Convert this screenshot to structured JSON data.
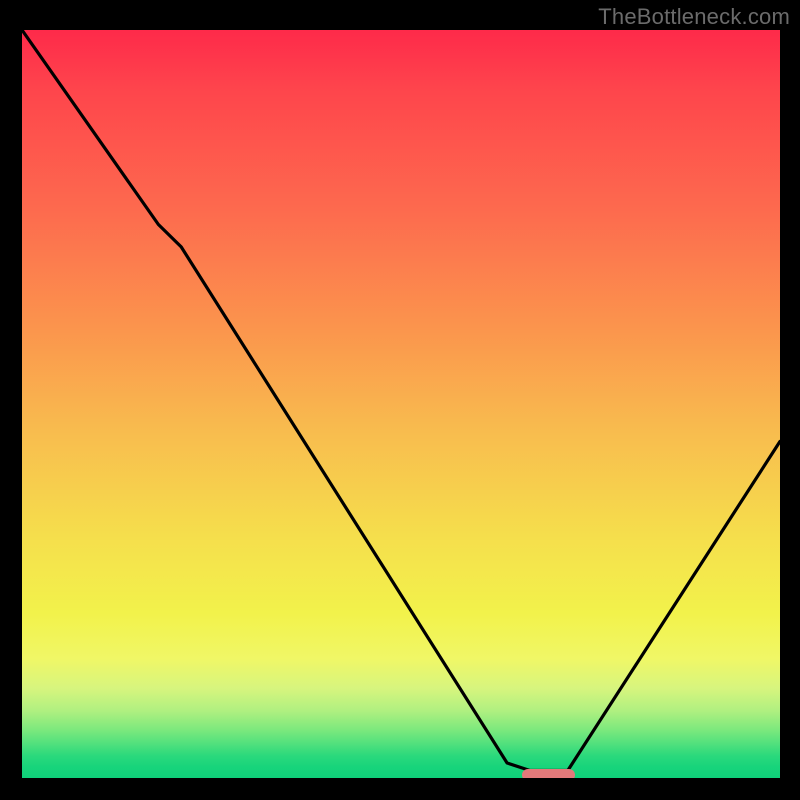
{
  "watermark": "TheBottleneck.com",
  "colors": {
    "background": "#000000",
    "curve": "#000000",
    "marker": "#e2797a",
    "watermark_text": "#6b6b6b"
  },
  "chart_data": {
    "type": "line",
    "title": "",
    "xlabel": "",
    "ylabel": "",
    "xlim": [
      0,
      100
    ],
    "ylim": [
      0,
      100
    ],
    "grid": false,
    "series": [
      {
        "name": "bottleneck-curve",
        "x": [
          0,
          18,
          21,
          64,
          67,
          72,
          100
        ],
        "values": [
          100,
          74,
          71,
          2,
          1,
          1,
          45
        ]
      }
    ],
    "annotations": [
      {
        "name": "optimal-marker",
        "x_start": 66,
        "x_end": 73,
        "y": 0.4
      }
    ]
  }
}
